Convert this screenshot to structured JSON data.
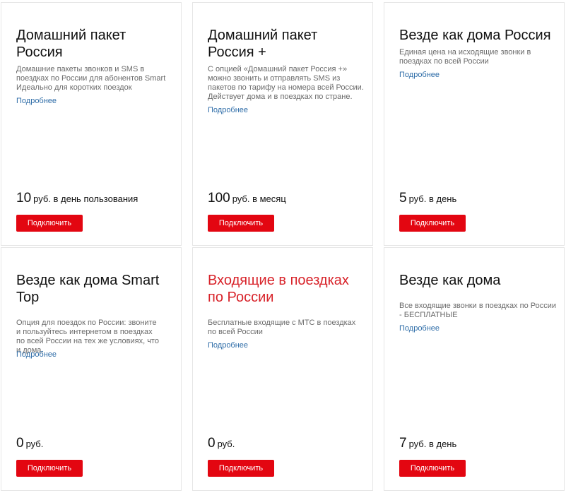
{
  "button_label": "Подключить",
  "more_label": "Подробнее",
  "accent_color": "#e30611",
  "link_color": "#2f6da8",
  "cards": [
    {
      "title": "Домашний пакет Россия",
      "description": "Домашние пакеты звонков и SMS в поездках по России для абонентов Smart Идеально для коротких поездок",
      "price_value": "10",
      "price_unit": "руб. в день пользования"
    },
    {
      "title": "Домашний пакет Россия +",
      "description": "С опцией «Домашний пакет Россия +» можно звонить и отправлять SMS из пакетов по тарифу на номера всей России. Действует дома и в поездках по стране.",
      "price_value": "100",
      "price_unit": "руб. в месяц"
    },
    {
      "title": "Везде как дома Россия",
      "description": "Единая цена на исходящие звонки в поездках по всей России",
      "price_value": "5",
      "price_unit": "руб. в день"
    },
    {
      "title": "Везде как дома Smart Top",
      "description": "Опция для поездок по России: звоните и пользуйтесь интернетом в поездках по всей России на тех же условиях, что и дома.",
      "price_value": "0",
      "price_unit": "руб."
    },
    {
      "title": "Входящие в поездках по России",
      "description": "Бесплатные входящие с МТС в поездках по всей России",
      "price_value": "0",
      "price_unit": "руб."
    },
    {
      "title": "Везде как дома",
      "description": "Все входящие звонки в поездках по России - БЕСПЛАТНЫЕ",
      "price_value": "7",
      "price_unit": "руб. в день"
    }
  ]
}
